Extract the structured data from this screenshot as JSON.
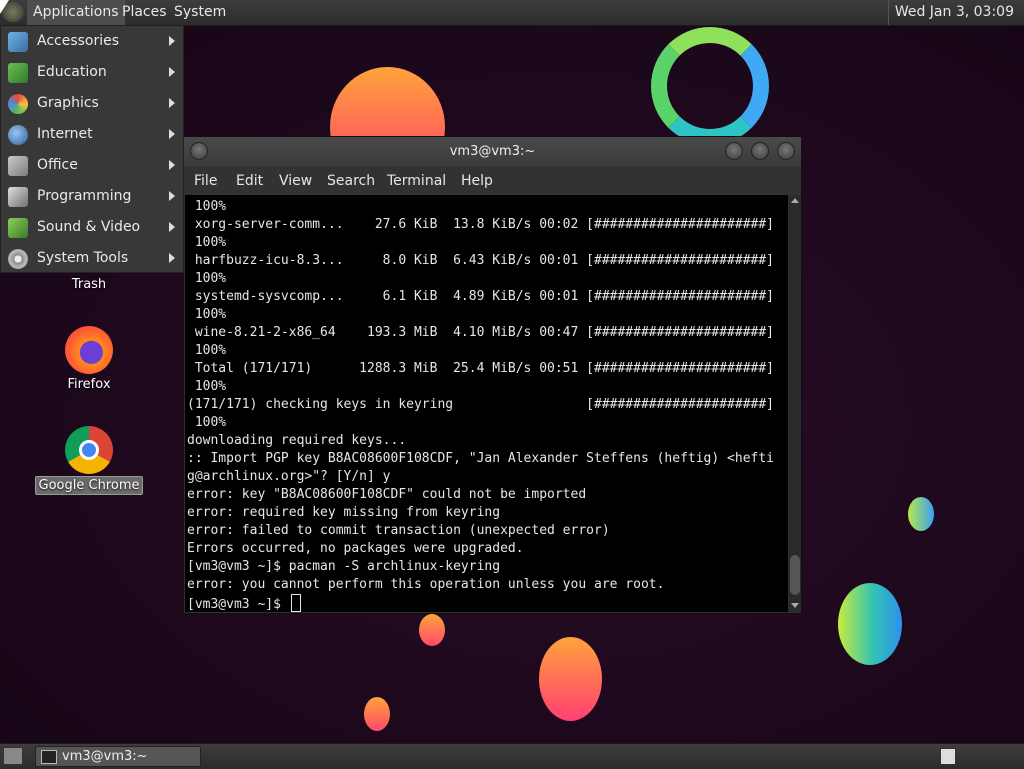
{
  "top_panel": {
    "menus": [
      "Applications",
      "Places",
      "System"
    ],
    "clock": "Wed Jan  3, 03:09"
  },
  "app_menu": {
    "items": [
      {
        "label": "Accessories",
        "icon": "accessories-icon"
      },
      {
        "label": "Education",
        "icon": "education-icon"
      },
      {
        "label": "Graphics",
        "icon": "graphics-icon"
      },
      {
        "label": "Internet",
        "icon": "internet-icon"
      },
      {
        "label": "Office",
        "icon": "office-icon"
      },
      {
        "label": "Programming",
        "icon": "programming-icon"
      },
      {
        "label": "Sound & Video",
        "icon": "sound-video-icon"
      },
      {
        "label": "System Tools",
        "icon": "system-tools-icon"
      }
    ]
  },
  "desktop_icons": {
    "trash": "Trash",
    "firefox": "Firefox",
    "chrome": "Google Chrome"
  },
  "terminal": {
    "title": "vm3@vm3:~",
    "menu": [
      "File",
      "Edit",
      "View",
      "Search",
      "Terminal",
      "Help"
    ],
    "lines": [
      " 100%",
      " xorg-server-comm...    27.6 KiB  13.8 KiB/s 00:02 [######################]",
      " 100%",
      " harfbuzz-icu-8.3...     8.0 KiB  6.43 KiB/s 00:01 [######################]",
      " 100%",
      " systemd-sysvcomp...     6.1 KiB  4.89 KiB/s 00:01 [######################]",
      " 100%",
      " wine-8.21-2-x86_64    193.3 MiB  4.10 MiB/s 00:47 [######################]",
      " 100%",
      " Total (171/171)      1288.3 MiB  25.4 MiB/s 00:51 [######################]",
      " 100%",
      "(171/171) checking keys in keyring                 [######################]",
      " 100%",
      "downloading required keys...",
      ":: Import PGP key B8AC08600F108CDF, \"Jan Alexander Steffens (heftig) <hefti",
      "g@archlinux.org>\"? [Y/n] y",
      "error: key \"B8AC08600F108CDF\" could not be imported",
      "error: required key missing from keyring",
      "error: failed to commit transaction (unexpected error)",
      "Errors occurred, no packages were upgraded.",
      "[vm3@vm3 ~]$ pacman -S archlinux-keyring",
      "error: you cannot perform this operation unless you are root."
    ],
    "prompt": "[vm3@vm3 ~]$ "
  },
  "bottom_panel": {
    "task_label": "vm3@vm3:~"
  },
  "colors": {
    "background": "#1d081c",
    "panel": "#333333",
    "terminal_bg": "#000000",
    "terminal_fg": "#e6e6e6"
  }
}
